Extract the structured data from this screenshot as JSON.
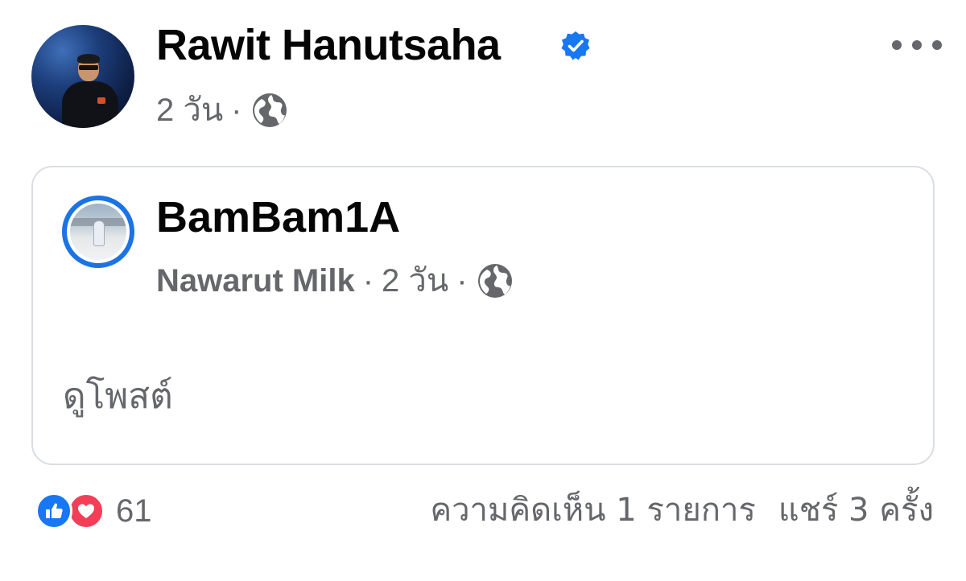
{
  "post": {
    "author_name": "Rawit Hanutsaha",
    "time": "2 วัน",
    "separator": "·",
    "privacy_icon": "globe-icon",
    "verified_icon": "verified-badge-icon",
    "menu_icon": "more-options-icon"
  },
  "shared": {
    "group_name": "BamBam1A",
    "poster_name": "Nawarut Milk",
    "time": "2 วัน",
    "separator": "·",
    "view_post_label": "ดูโพสต์"
  },
  "footer": {
    "reaction_count": "61",
    "comments_label": "ความคิดเห็น 1 รายการ",
    "shares_label": "แชร์ 3 ครั้ง"
  },
  "colors": {
    "primary_text": "#050505",
    "secondary_text": "#65676b",
    "brand_blue": "#1877f2",
    "love_red": "#f33e58",
    "card_border": "#dadde1"
  }
}
